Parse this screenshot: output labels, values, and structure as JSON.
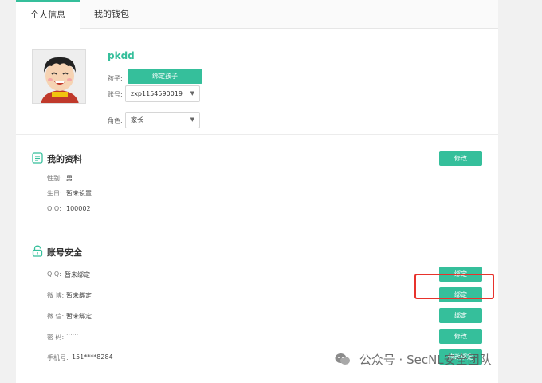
{
  "tabs": [
    {
      "label": "个人信息"
    },
    {
      "label": "我的钱包"
    }
  ],
  "profile": {
    "username": "pkdd",
    "child_label": "孩子:",
    "bind_child_button": "绑定孩子",
    "account_label": "账号:",
    "account_value": "zxp1154590019",
    "role_label": "角色:",
    "role_value": "家长"
  },
  "my_info": {
    "title": "我的资料",
    "edit_button": "修改",
    "rows": [
      {
        "label": "性别:",
        "value": "男"
      },
      {
        "label": "生日:",
        "value": "暂未设置"
      },
      {
        "label": "Q Q:",
        "value": "100002"
      }
    ]
  },
  "security": {
    "title": "账号安全",
    "rows": [
      {
        "label": "Q Q:",
        "value": "暂未绑定",
        "button": "绑定"
      },
      {
        "label": "微 博:",
        "value": "暂未绑定",
        "button": "绑定"
      },
      {
        "label": "微 信:",
        "value": "暂未绑定",
        "button": "绑定"
      },
      {
        "label": "密 码:",
        "value": "······",
        "button": "修改"
      },
      {
        "label": "手机号:",
        "value": "151****8284",
        "button": "修改绑定"
      }
    ]
  },
  "watermark": "公众号 · SecNL安全团队",
  "colors": {
    "accent": "#35bf9b",
    "highlight": "#e8322c"
  }
}
